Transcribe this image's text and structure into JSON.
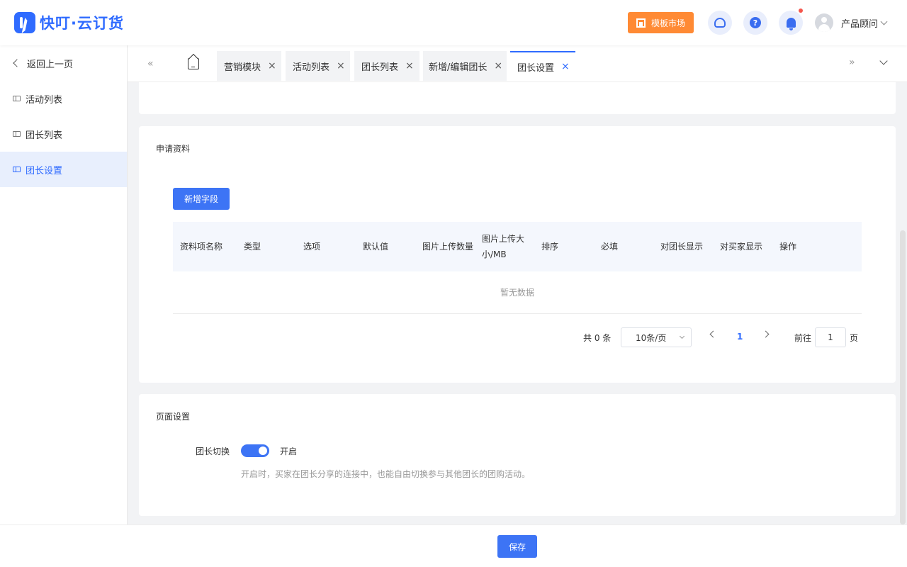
{
  "header": {
    "app_name": "快叮·云订货",
    "market_button": "模板市场",
    "help_glyph": "?",
    "user_name": "产品顾问",
    "icons": [
      "headset-icon",
      "help-icon",
      "bell-icon",
      "avatar",
      "chevron-down-icon"
    ]
  },
  "sidebar": {
    "back": "返回上一页",
    "items": [
      {
        "label": "活动列表",
        "active": false
      },
      {
        "label": "团长列表",
        "active": false
      },
      {
        "label": "团长设置",
        "active": true
      }
    ]
  },
  "tabs": {
    "prev_glyph": "«",
    "next_glyph": "»",
    "close_glyph": "×",
    "items": [
      {
        "label": "营销模块",
        "active": false
      },
      {
        "label": "活动列表",
        "active": false
      },
      {
        "label": "团长列表",
        "active": false
      },
      {
        "label": "新增/编辑团长",
        "active": false
      },
      {
        "label": "团长设置",
        "active": true
      }
    ]
  },
  "application": {
    "title": "申请资料",
    "add_field_button": "新增字段",
    "columns": [
      "资料项名称",
      "类型",
      "选项",
      "默认值",
      "图片上传数量",
      "图片上传大小/MB",
      "排序",
      "必填",
      "对团长显示",
      "对买家显示",
      "操作"
    ],
    "empty_text": "暂无数据",
    "pagination": {
      "total": "共 0 条",
      "page_size": "10条/页",
      "current_page": "1",
      "goto_label": "前往",
      "goto_value": "1",
      "page_suffix": "页"
    }
  },
  "page_settings": {
    "title": "页面设置",
    "switch_label": "团长切换",
    "switch_on": true,
    "switch_state_text": "开启",
    "hint": "开启时，买家在团长分享的连接中，也能自由切换参与其他团长的团购活动。"
  },
  "footer": {
    "save_button": "保存"
  },
  "colors": {
    "primary": "#3d74f5",
    "brand": "#2f6bff",
    "market_orange": "#ff8a34",
    "notify_dot": "#f5564d"
  }
}
